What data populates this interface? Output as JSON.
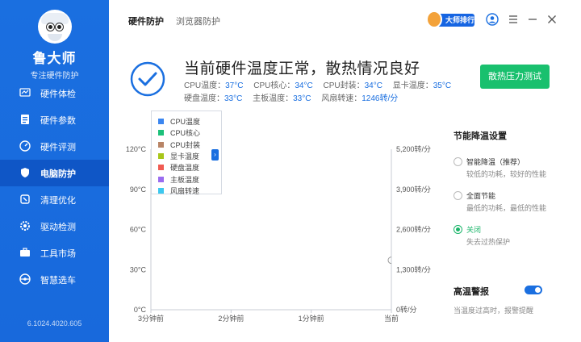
{
  "app": {
    "name": "鲁大师",
    "subtitle": "专注硬件防护",
    "version": "6.1024.4020.605"
  },
  "sidebar": {
    "items": [
      {
        "label": "硬件体检",
        "icon": "monitor-chart-icon",
        "active": false
      },
      {
        "label": "硬件参数",
        "icon": "document-list-icon",
        "active": false
      },
      {
        "label": "硬件评测",
        "icon": "speedometer-icon",
        "active": false
      },
      {
        "label": "电脑防护",
        "icon": "shield-icon",
        "active": true
      },
      {
        "label": "清理优化",
        "icon": "broom-icon",
        "active": false
      },
      {
        "label": "驱动检测",
        "icon": "gear-icon",
        "active": false
      },
      {
        "label": "工具市场",
        "icon": "toolbox-icon",
        "active": false
      },
      {
        "label": "智慧选车",
        "icon": "steering-wheel-icon",
        "active": false
      }
    ]
  },
  "header": {
    "tabs": [
      {
        "label": "硬件防护",
        "active": true
      },
      {
        "label": "浏览器防护",
        "active": false
      }
    ],
    "rank_label": "大师排行"
  },
  "status": {
    "title": "当前硬件温度正常，散热情况良好",
    "temps_row1": [
      {
        "label": "CPU温度：",
        "value": "37°C"
      },
      {
        "label": "CPU核心：",
        "value": "34°C"
      },
      {
        "label": "CPU封装：",
        "value": "34°C"
      },
      {
        "label": "显卡温度：",
        "value": "35°C"
      }
    ],
    "temps_row2": [
      {
        "label": "硬盘温度：",
        "value": "33°C"
      },
      {
        "label": "主板温度：",
        "value": "33°C"
      },
      {
        "label": "风扇转速：",
        "value": "1246转/分"
      }
    ],
    "stress_button": "散热压力测试"
  },
  "chart_data": {
    "type": "line",
    "title": "",
    "left_axis_ticks": [
      "0°C",
      "30°C",
      "60°C",
      "90°C",
      "120°C"
    ],
    "right_axis_ticks": [
      "0转/分",
      "1,300转/分",
      "2,600转/分",
      "3,900转/分",
      "5,200转/分"
    ],
    "x_ticks": [
      "3分钟前",
      "2分钟前",
      "1分钟前",
      "当前"
    ],
    "ylim_left": [
      0,
      120
    ],
    "ylim_right": [
      0,
      5200
    ],
    "legend_position": "top-left",
    "series": [
      {
        "name": "CPU温度",
        "color": "#3b86f0",
        "last": 37
      },
      {
        "name": "CPU核心",
        "color": "#1cc07a",
        "last": 34
      },
      {
        "name": "CPU封装",
        "color": "#b88466",
        "last": 34
      },
      {
        "name": "显卡温度",
        "color": "#a8c61a",
        "last": 35
      },
      {
        "name": "硬盘温度",
        "color": "#f05b52",
        "last": 33
      },
      {
        "name": "主板温度",
        "color": "#9a6cf0",
        "last": 33
      },
      {
        "name": "风扇转速",
        "color": "#3cc8ef",
        "last": 1246
      }
    ]
  },
  "settings": {
    "title": "节能降温设置",
    "options": [
      {
        "label": "智能降温（推荐）",
        "desc": "较低的功耗，较好的性能",
        "selected": false
      },
      {
        "label": "全面节能",
        "desc": "最低的功耗，最低的性能",
        "selected": false
      },
      {
        "label": "关闭",
        "desc": "失去过热保护",
        "selected": true
      }
    ],
    "alarm_title": "高温警报",
    "alarm_enabled": true,
    "alarm_desc": "当温度过高时，报警提醒"
  },
  "colors": {
    "sidebar": "#1a6fe0",
    "sidebar_active": "#0f56c6",
    "accent_green": "#19c06e",
    "accent_blue": "#1a6fe0"
  }
}
